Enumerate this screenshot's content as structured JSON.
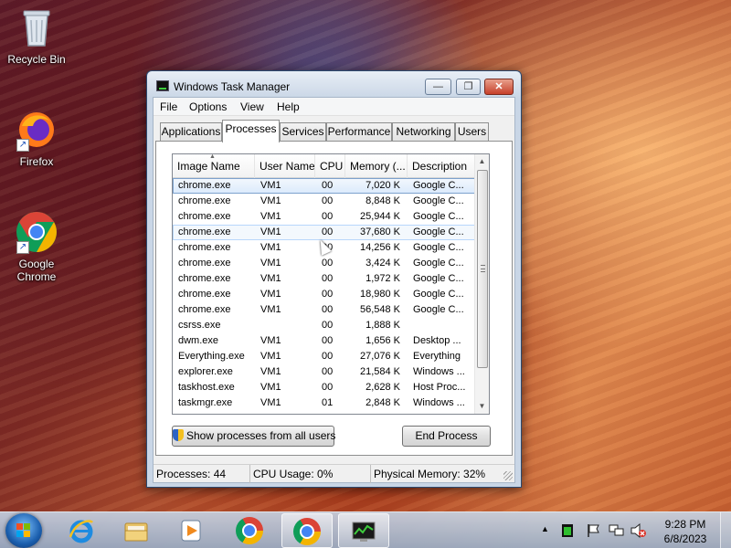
{
  "desktop": {
    "icons": [
      {
        "label": "Recycle Bin",
        "icon": "recycle-bin-icon"
      },
      {
        "label": "Firefox",
        "icon": "firefox-icon"
      },
      {
        "label": "Google Chrome",
        "icon": "chrome-icon"
      }
    ]
  },
  "window": {
    "title": "Windows Task Manager",
    "buttons": {
      "minimize": "—",
      "maximize": "❐",
      "close": "✕"
    },
    "menu": [
      "File",
      "Options",
      "View",
      "Help"
    ],
    "tabs": [
      "Applications",
      "Processes",
      "Services",
      "Performance",
      "Networking",
      "Users"
    ],
    "active_tab": "Processes",
    "columns": [
      "Image Name",
      "User Name",
      "CPU",
      "Memory (...",
      "Description"
    ],
    "processes": [
      {
        "name": "chrome.exe",
        "user": "VM1",
        "cpu": "00",
        "mem": "7,020 K",
        "desc": "Google C..."
      },
      {
        "name": "chrome.exe",
        "user": "VM1",
        "cpu": "00",
        "mem": "8,848 K",
        "desc": "Google C..."
      },
      {
        "name": "chrome.exe",
        "user": "VM1",
        "cpu": "00",
        "mem": "25,944 K",
        "desc": "Google C..."
      },
      {
        "name": "chrome.exe",
        "user": "VM1",
        "cpu": "00",
        "mem": "37,680 K",
        "desc": "Google C..."
      },
      {
        "name": "chrome.exe",
        "user": "VM1",
        "cpu": "00",
        "mem": "14,256 K",
        "desc": "Google C..."
      },
      {
        "name": "chrome.exe",
        "user": "VM1",
        "cpu": "00",
        "mem": "3,424 K",
        "desc": "Google C..."
      },
      {
        "name": "chrome.exe",
        "user": "VM1",
        "cpu": "00",
        "mem": "1,972 K",
        "desc": "Google C..."
      },
      {
        "name": "chrome.exe",
        "user": "VM1",
        "cpu": "00",
        "mem": "18,980 K",
        "desc": "Google C..."
      },
      {
        "name": "chrome.exe",
        "user": "VM1",
        "cpu": "00",
        "mem": "56,548 K",
        "desc": "Google C..."
      },
      {
        "name": "csrss.exe",
        "user": "",
        "cpu": "00",
        "mem": "1,888 K",
        "desc": ""
      },
      {
        "name": "dwm.exe",
        "user": "VM1",
        "cpu": "00",
        "mem": "1,656 K",
        "desc": "Desktop ..."
      },
      {
        "name": "Everything.exe",
        "user": "VM1",
        "cpu": "00",
        "mem": "27,076 K",
        "desc": "Everything"
      },
      {
        "name": "explorer.exe",
        "user": "VM1",
        "cpu": "00",
        "mem": "21,584 K",
        "desc": "Windows ..."
      },
      {
        "name": "taskhost.exe",
        "user": "VM1",
        "cpu": "00",
        "mem": "2,628 K",
        "desc": "Host Proc..."
      },
      {
        "name": "taskmgr.exe",
        "user": "VM1",
        "cpu": "01",
        "mem": "2,848 K",
        "desc": "Windows ..."
      }
    ],
    "selected_row": 0,
    "hovered_row": 3,
    "show_all_label": "Show processes from all users",
    "end_process_label": "End Process",
    "status": {
      "processes": "Processes: 44",
      "cpu": "CPU Usage: 0%",
      "memory": "Physical Memory: 32%"
    }
  },
  "taskbar": {
    "items": [
      {
        "name": "internet-explorer",
        "open": false
      },
      {
        "name": "windows-explorer",
        "open": false
      },
      {
        "name": "media-player",
        "open": false
      },
      {
        "name": "google-chrome",
        "open": false
      },
      {
        "name": "google-chrome-running",
        "open": true
      },
      {
        "name": "task-manager",
        "open": true
      }
    ],
    "tray": {
      "show_hidden": "▲",
      "time": "9:28 PM",
      "date": "6/8/2023"
    }
  },
  "colors": {
    "selection": "#dcebfc",
    "selection_border": "#7da2ce",
    "close_button": "#c7402a"
  }
}
